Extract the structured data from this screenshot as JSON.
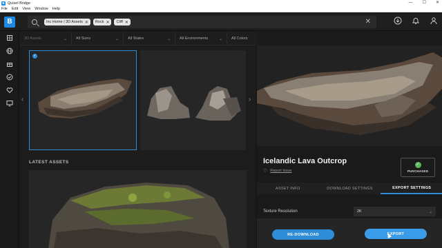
{
  "window": {
    "title": "Quixel Bridge",
    "controls": [
      "—",
      "☐",
      "✕"
    ]
  },
  "menu": [
    "File",
    "Edit",
    "View",
    "Window",
    "Help"
  ],
  "header": {
    "brand": "B",
    "search_chips": [
      {
        "label": "Inc Home / 3D Assets"
      },
      {
        "label": "Rock"
      },
      {
        "label": "Cliff"
      }
    ]
  },
  "filters": [
    {
      "label": "3D Assets"
    },
    {
      "label": "All Sizes"
    },
    {
      "label": "All States"
    },
    {
      "label": "All Environments"
    },
    {
      "label": "All Colors"
    }
  ],
  "grid": {
    "latest_title": "LATEST ASSETS"
  },
  "panel": {
    "asset_title": "Icelandic Lava Outcrop",
    "report_issue": "Report Issue",
    "purchased_label": "PURCHASED",
    "tabs": [
      {
        "label": "ASSET INFO",
        "active": false
      },
      {
        "label": "DOWNLOAD SETTINGS",
        "active": false
      },
      {
        "label": "EXPORT SETTINGS",
        "active": true
      }
    ],
    "texture_resolution_label": "Texture Resolution",
    "texture_resolution_value": "2K",
    "redownload_label": "RE-DOWNLOAD",
    "export_label": "EXPORT"
  },
  "colors": {
    "accent": "#2f8dd8",
    "success": "#5cb85c"
  }
}
